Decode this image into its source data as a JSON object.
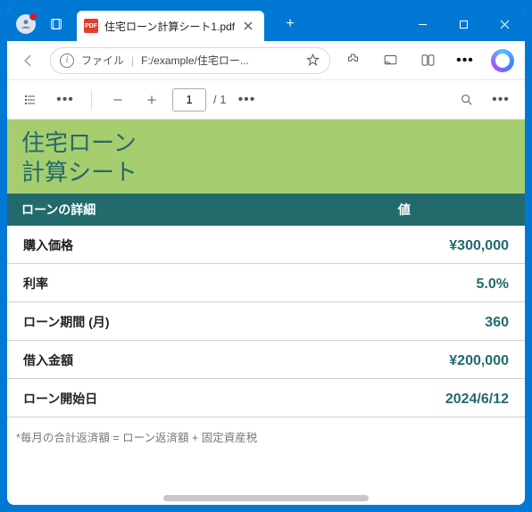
{
  "tab": {
    "title": "住宅ローン計算シート1.pdf"
  },
  "addr": {
    "scheme": "ファイル",
    "path": "F:/example/住宅ロー..."
  },
  "pdfbar": {
    "page": "1",
    "total": "/ 1"
  },
  "doc": {
    "title1": "住宅ローン",
    "title2": "計算シート",
    "col1": "ローンの詳細",
    "col2": "値",
    "rows": [
      {
        "label": "購入価格",
        "value": "¥300,000"
      },
      {
        "label": "利率",
        "value": "5.0%"
      },
      {
        "label": "ローン期間 (月)",
        "value": "360"
      },
      {
        "label": "借入金額",
        "value": "¥200,000"
      },
      {
        "label": "ローン開始日",
        "value": "2024/6/12"
      }
    ],
    "footnote": "*毎月の合計返済額 = ローン返済額 + 固定資産税"
  }
}
